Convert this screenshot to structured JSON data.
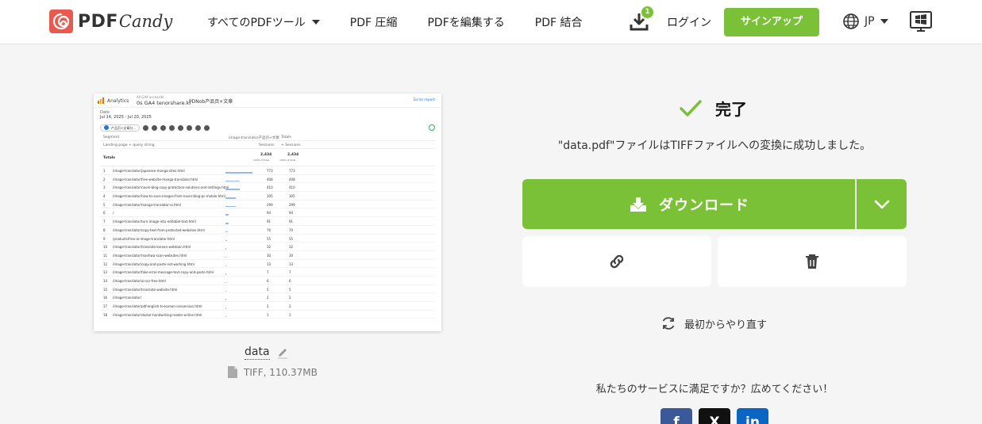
{
  "header": {
    "logo": {
      "pdf": "PDF",
      "candy": "Candy"
    },
    "nav": [
      {
        "label": "すべてのPDFツール",
        "has_dropdown": true
      },
      {
        "label": "PDF 圧縮"
      },
      {
        "label": "PDFを編集する"
      },
      {
        "label": "PDF 結合"
      }
    ],
    "download_badge": "1",
    "login_label": "ログイン",
    "signup_label": "サインアップ",
    "language_label": "JP",
    "brand_color": "#7bc137"
  },
  "preview": {
    "app_name": "Analytics",
    "property_small": "All GA4 accessibl...",
    "property_name": "0s GA4 tenorshare.kr",
    "report_title": "PDNob产品页+文章",
    "goto_report": "Go to report",
    "date_label": "Date",
    "date_range": "Jul 14, 2025 - Jul 20, 2025",
    "filter_label": "产品页+文章分...",
    "col_segment": "Segment",
    "col_segment_value": "image-translator产品页+文章",
    "col_totals": "Totals",
    "col_dimension": "Landing page + query string",
    "col_sessions": "Sessions",
    "col_sessions_total": "+ Sessions",
    "totals_label": "Totals",
    "totals_value": "2,434",
    "totals_value_right": "2,434",
    "totals_sub": "100% of total",
    "totals_sub_right": "100% of total",
    "rows": [
      {
        "n": "1",
        "page": "/image-translator/japanese-manga-sites.html",
        "v": "773"
      },
      {
        "n": "2",
        "page": "/image-translator/free-website-manga-translator.html",
        "v": "408"
      },
      {
        "n": "3",
        "page": "/image-translator/naver-blog-copy-protection-solutions-and-settings.html",
        "v": "410"
      },
      {
        "n": "4",
        "page": "/image-translator/how-to-save-images-from-naver-blog-pc-mobile.html",
        "v": "305"
      },
      {
        "n": "5",
        "page": "/image-translator/manga-translator-ai.html",
        "v": "299"
      },
      {
        "n": "6",
        "page": "/",
        "v": "94"
      },
      {
        "n": "7",
        "page": "/image-translator/turn-image-into-editable-text.html",
        "v": "91"
      },
      {
        "n": "8",
        "page": "/image-translator/copy-text-from-protected-websites.html",
        "v": "70"
      },
      {
        "n": "9",
        "page": "/products/free-ai-image-translator.html",
        "v": "55"
      },
      {
        "n": "10",
        "page": "/image-translator/translate-korean-webtoon.html",
        "v": "32"
      },
      {
        "n": "11",
        "page": "/image-translator/manhwa-scan-websites.html",
        "v": "30"
      },
      {
        "n": "12",
        "page": "/image-translator/copy-and-paste-not-working.html",
        "v": "13"
      },
      {
        "n": "13",
        "page": "/image-translator/fake-error-message-text-copy-and-paste.html",
        "v": "7"
      },
      {
        "n": "14",
        "page": "/image-translator/ai-ocr-free.html",
        "v": "6"
      },
      {
        "n": "15",
        "page": "/image-translator/translate-website.html",
        "v": "5"
      },
      {
        "n": "16",
        "page": "/image-translator/",
        "v": "2"
      },
      {
        "n": "17",
        "page": "/image-translator/pdf-english-to-korean-conversion.html",
        "v": "2"
      },
      {
        "n": "18",
        "page": "/image-translator/doctor-handwriting-reader-online.html",
        "v": "1"
      }
    ]
  },
  "file": {
    "name": "data",
    "meta": "TIFF, 110.37MB"
  },
  "result": {
    "title": "完了",
    "message": "\"data.pdf\"ファイルはTIFFファイルへの変換に成功しました。",
    "download_label": "ダウンロード",
    "restart_label": "最初からやり直す",
    "satisfaction": "私たちのサービスに満足ですか？広めてください！"
  },
  "social": {
    "facebook_color": "#3b5998",
    "x_color": "#111111",
    "linkedin_color": "#0a66c2"
  }
}
